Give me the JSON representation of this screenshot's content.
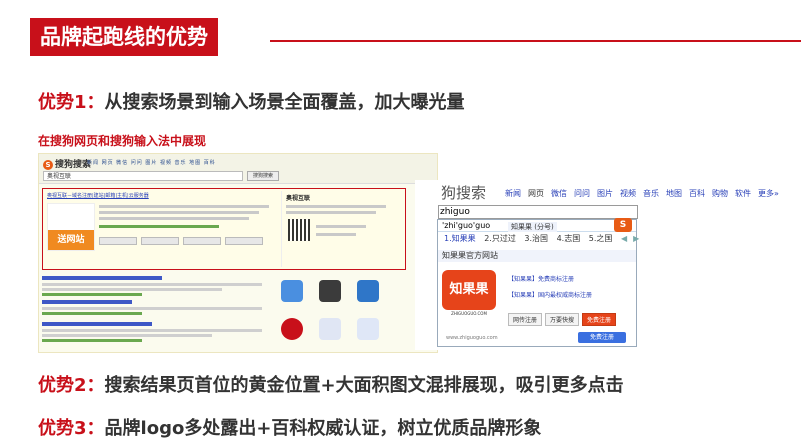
{
  "title": "品牌起跑线的优势",
  "advantages": [
    {
      "label": "优势1：",
      "text": "从搜索场景到输入场景全面覆盖，加大曝光量"
    },
    {
      "label": "优势2：",
      "text": "搜索结果页首位的黄金位置+大面积图文混排展现，吸引更多点击"
    },
    {
      "label": "优势3：",
      "text": "品牌logo多处露出+百科权威认证，树立优质品牌形象"
    }
  ],
  "caption": "在搜狗网页和搜狗输入法中展现",
  "left_screenshot": {
    "logo": "搜狗搜索",
    "search_value": "奥视互联",
    "search_button": "搜狗搜索",
    "brand_badge": "送网站",
    "side_title": "奥视互联"
  },
  "right_screenshot": {
    "brand": "狗搜索",
    "tabs": [
      "新闻",
      "网页",
      "微信",
      "问问",
      "图片",
      "视频",
      "音乐",
      "地图",
      "百科",
      "购物",
      "软件",
      "更多»"
    ],
    "active_tab": "网页",
    "input_value": "zhiguo",
    "field_text": "'zhi'guo'guo",
    "pinyin_chip": "知果果 (分号)",
    "candidates": [
      "1.知果果",
      "2.只过过",
      "3.治国",
      "4.志国",
      "5.之国"
    ],
    "dropdown_heading": "知果果官方网站",
    "dropdown_logo": "知果果",
    "dropdown_logo_domain": "ZHIGUOGUO.COM",
    "links": [
      "【知果果】免费商标注册",
      "【知果果】国内最权威商标注册"
    ],
    "buttons": [
      "网传注册",
      "万要快搜",
      "免费注册"
    ],
    "footer_url": "www.zhiguoguo.com",
    "free_button": "免费注册",
    "ime_icon": "S"
  },
  "colors": {
    "accent": "#c8101a",
    "text": "#333333",
    "link": "#2a41b8"
  }
}
